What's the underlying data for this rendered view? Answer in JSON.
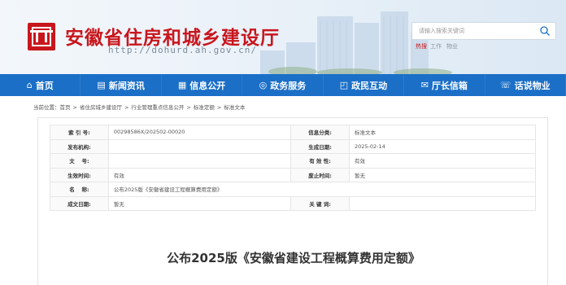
{
  "header": {
    "site_title": "安徽省住房和城乡建设厅",
    "site_url": "http://dohurd.ah.gov.cn/",
    "search_placeholder": "请输入搜索关键词",
    "hot_label": "热搜",
    "hot_words": [
      "工作",
      "物业"
    ]
  },
  "colors": {
    "brand_red": "#c8161d",
    "nav_blue": "#1b6fc7"
  },
  "nav": [
    {
      "icon": "home-icon",
      "glyph": "⌂",
      "label": "首页"
    },
    {
      "icon": "newspaper-icon",
      "glyph": "▤",
      "label": "新闻资讯"
    },
    {
      "icon": "document-list-icon",
      "glyph": "▦",
      "label": "信息公开"
    },
    {
      "icon": "services-icon",
      "glyph": "◎",
      "label": "政务服务"
    },
    {
      "icon": "chat-icon",
      "glyph": "◰",
      "label": "政民互动"
    },
    {
      "icon": "mailbox-icon",
      "glyph": "✉",
      "label": "厅长信箱"
    },
    {
      "icon": "phone-icon",
      "glyph": "☏",
      "label": "话说物业"
    }
  ],
  "breadcrumb": {
    "prefix": "当前位置：",
    "items": [
      "首页",
      "省住房城乡建设厅",
      "行业管理重点信息公开",
      "标准定额",
      "标准文本"
    ],
    "separator": ">"
  },
  "info": {
    "index_no_label": "索 引 号:",
    "index_no": "00298586X/202502-00020",
    "category_label": "信息分类:",
    "category": "标准文本",
    "publisher_label": "发布机构:",
    "publisher": "",
    "created_label": "生成日期:",
    "created": "2025-02-14",
    "doc_no_label": "文　 号:",
    "doc_no": "",
    "validity_label": "有 效 性:",
    "validity": "有效",
    "effective_label": "生效时间:",
    "effective": "有效",
    "repeal_label": "废止时间:",
    "repeal": "暂无",
    "name_label": "名　 称:",
    "name": "公布2025版《安徽省建设工程概算费用定额》",
    "compose_label": "成文日期:",
    "compose": "暂无",
    "keywords_label": "关 键 词:",
    "keywords": ""
  },
  "doc_title": "公布2025版《安徽省建设工程概算费用定额》"
}
